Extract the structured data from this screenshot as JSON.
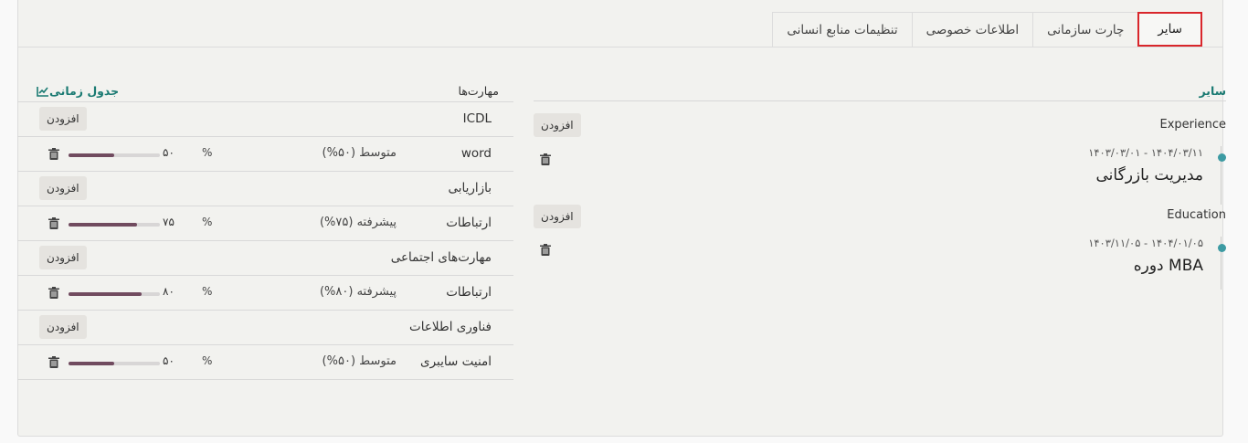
{
  "tabs": [
    {
      "label": "سایر",
      "active": true
    },
    {
      "label": "چارت سازمانی",
      "active": false
    },
    {
      "label": "اطلاعات خصوصی",
      "active": false
    },
    {
      "label": "تنظیمات منابع انسانی",
      "active": false
    }
  ],
  "other": {
    "title": "سایر",
    "add_label": "افزودن",
    "groups": [
      {
        "title": "Experience",
        "item": {
          "date": "۱۴۰۳/۰۳/۰۱ - ۱۴۰۴/۰۳/۱۱",
          "title": "مدیریت بازرگانی"
        }
      },
      {
        "title": "Education",
        "item": {
          "date": "۱۴۰۳/۱۱/۰۵ - ۱۴۰۴/۰۱/۰۵",
          "title": "دوره MBA"
        }
      }
    ]
  },
  "skills": {
    "title": "مهارت‌ها",
    "timeline_link": "جدول زمانی",
    "percent_sign": "%",
    "add_label": "افزودن",
    "groups": [
      {
        "category": "ICDL",
        "skill": {
          "name": "word",
          "level": "متوسط (۵۰%)",
          "value": "۵۰",
          "progress": 0.5
        }
      },
      {
        "category": "بازاریابی",
        "skill": {
          "name": "ارتباطات",
          "level": "پیشرفته (۷۵%)",
          "value": "۷۵",
          "progress": 0.75
        }
      },
      {
        "category": "مهارت‌های اجتماعی",
        "skill": {
          "name": "ارتباطات",
          "level": "پیشرفته (۸۰%)",
          "value": "۸۰",
          "progress": 0.8
        }
      },
      {
        "category": "فناوری اطلاعات",
        "skill": {
          "name": "امنیت سایبری",
          "level": "متوسط (۵۰%)",
          "value": "۵۰",
          "progress": 0.5
        }
      }
    ]
  },
  "colors": {
    "accent": "#1a7a72",
    "dot": "#3d9ba3",
    "bar": "#714b5f",
    "active_tab_border": "#d9262b"
  },
  "icons": {
    "trash": "trash-icon",
    "chart": "line-chart-icon"
  }
}
